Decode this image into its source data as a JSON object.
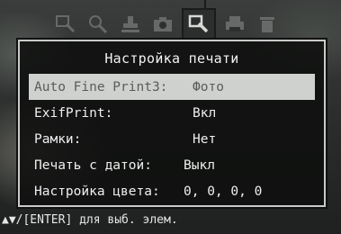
{
  "icons": [
    {
      "name": "zoom-rect-icon"
    },
    {
      "name": "zoom-circle-icon"
    },
    {
      "name": "stamp-icon"
    },
    {
      "name": "camera-icon"
    },
    {
      "name": "print-setup-icon"
    },
    {
      "name": "printer-icon"
    },
    {
      "name": "trash-icon"
    }
  ],
  "menu": {
    "title": "Настройка печати",
    "items": [
      {
        "label": "Auto Fine Print3:",
        "value": "Фото"
      },
      {
        "label": "ExifPrint:",
        "value": "Вкл"
      },
      {
        "label": "Рамки:",
        "value": "Нет"
      },
      {
        "label": "Печать с датой:",
        "value": "Выкл"
      },
      {
        "label": "Настройка цвета:",
        "value": "0, 0, 0, 0"
      }
    ]
  },
  "help_text": "▲▼/[ENTER] для выб. элем.",
  "colors": {
    "selected_bg": "#cfd1cf",
    "text": "#efefef",
    "border": "#c9cbc9"
  }
}
